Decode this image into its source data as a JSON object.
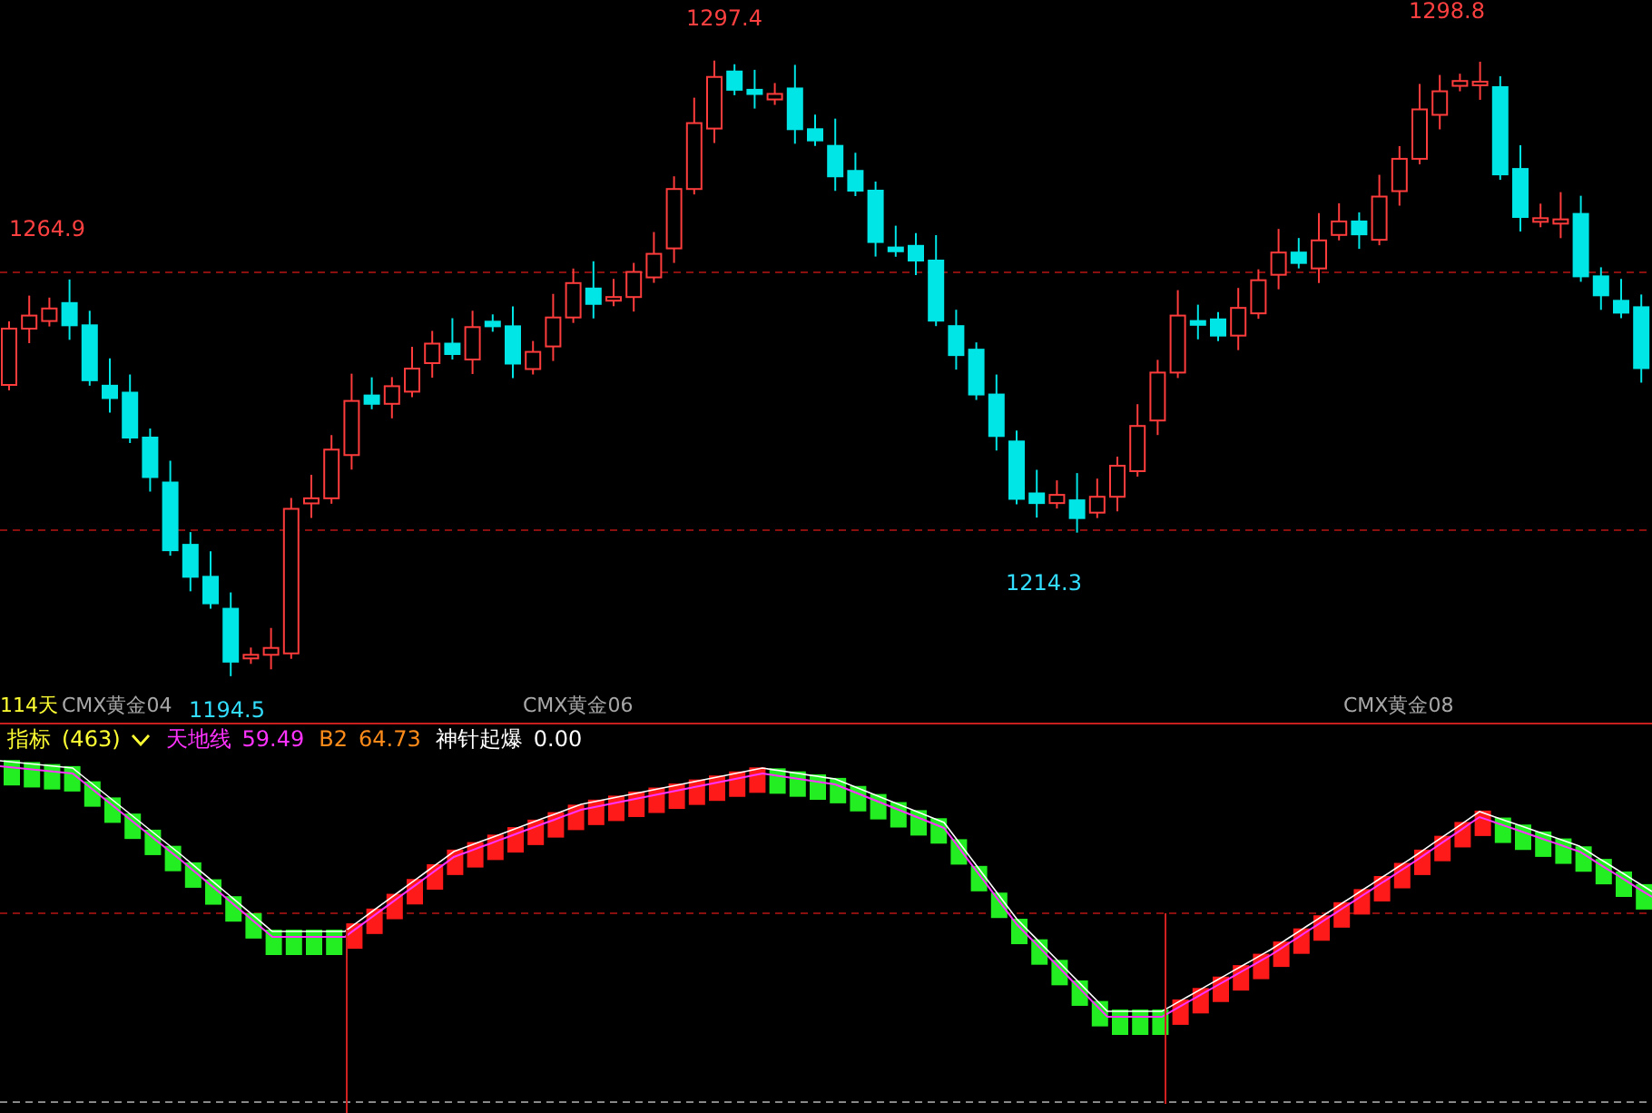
{
  "price_labels": [
    {
      "text": "1297.4",
      "kind": "high"
    },
    {
      "text": "1298.8",
      "kind": "high"
    },
    {
      "text": "1264.9",
      "kind": "high"
    },
    {
      "text": "1214.3",
      "kind": "low"
    },
    {
      "text": "1194.5",
      "kind": "low"
    }
  ],
  "axis_labels": [
    {
      "text": "114天",
      "kind": "count"
    },
    {
      "text": "CMX黄金04",
      "kind": "period"
    },
    {
      "text": "CMX黄金06",
      "kind": "period"
    },
    {
      "text": "CMX黄金08",
      "kind": "period"
    }
  ],
  "indicator": {
    "name": "指标",
    "count": "(463)",
    "lines": [
      {
        "name": "天地线",
        "value": "59.49",
        "color": "#ff33ff"
      },
      {
        "name": "B2",
        "value": "64.73",
        "color": "#ff8c1a"
      },
      {
        "name": "神针起爆",
        "value": "0.00",
        "color": "#ffffff"
      }
    ]
  }
}
